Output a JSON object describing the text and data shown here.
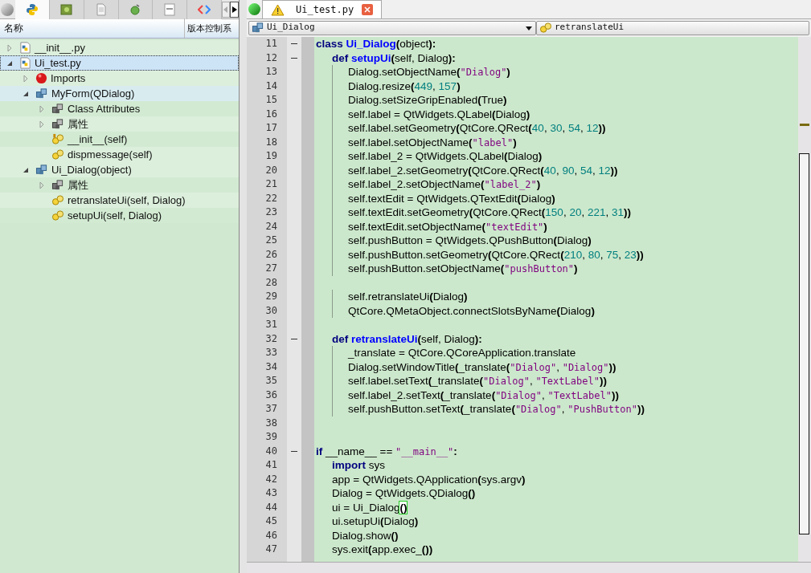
{
  "left_tabs": [
    {
      "kind": "python",
      "selected": true
    },
    {
      "kind": "image",
      "selected": false
    },
    {
      "kind": "page",
      "selected": false
    },
    {
      "kind": "bug",
      "selected": false
    },
    {
      "kind": "idl",
      "selected": false
    },
    {
      "kind": "protocol",
      "selected": false
    }
  ],
  "tree": {
    "columns": [
      "名称",
      "版本控制系"
    ],
    "items": [
      {
        "label": "__init__.py",
        "kind": "file",
        "expanded": false,
        "selected": false
      },
      {
        "label": "Ui_test.py",
        "kind": "file",
        "expanded": true,
        "selected": true,
        "children": [
          {
            "label": "Imports",
            "kind": "error",
            "expanded": false,
            "selected": false
          },
          {
            "label": "MyForm(QDialog)",
            "kind": "class",
            "expanded": true,
            "selected": false,
            "hovered": true,
            "children": [
              {
                "label": "Class Attributes",
                "kind": "attrs",
                "expanded": false,
                "selected": false
              },
              {
                "label": "属性",
                "kind": "attrs",
                "expanded": false,
                "selected": false
              },
              {
                "label": "__init__(self)",
                "kind": "init",
                "selected": false
              },
              {
                "label": "dispmessage(self)",
                "kind": "method",
                "selected": false
              }
            ]
          },
          {
            "label": "Ui_Dialog(object)",
            "kind": "class",
            "expanded": true,
            "selected": false,
            "children": [
              {
                "label": "属性",
                "kind": "attrs",
                "expanded": false,
                "selected": false
              },
              {
                "label": "retranslateUi(self, Dialog)",
                "kind": "method",
                "selected": false
              },
              {
                "label": "setupUi(self, Dialog)",
                "kind": "method",
                "selected": false
              }
            ]
          }
        ]
      }
    ]
  },
  "editor_tab": {
    "title": "Ui_test.py",
    "warning": true
  },
  "class_combo": "Ui_Dialog",
  "method_combo": "retranslateUi",
  "lines": [
    {
      "no": "11",
      "fold": true,
      "tokens": [
        {
          "kind": "kw",
          "text": "class "
        },
        {
          "kind": "fn",
          "text": "Ui_Dialog"
        },
        {
          "kind": "p",
          "text": "("
        },
        {
          "kind": "x",
          "text": "object"
        },
        {
          "kind": "p",
          "text": "):"
        }
      ]
    },
    {
      "no": "12",
      "fold": true,
      "tokens": [
        {
          "kind": "kw",
          "text": "    def "
        },
        {
          "kind": "fn",
          "text": "setupUi"
        },
        {
          "kind": "p",
          "text": "("
        },
        {
          "kind": "x",
          "text": "self, Dialog"
        },
        {
          "kind": "p",
          "text": "):"
        }
      ]
    },
    {
      "no": "13",
      "fold": false,
      "tokens": [
        {
          "kind": "x",
          "text": "        Dialog.setObjectName"
        },
        {
          "kind": "p",
          "text": "("
        },
        {
          "kind": "s",
          "text": "\"Dialog\""
        },
        {
          "kind": "p",
          "text": ")"
        }
      ]
    },
    {
      "no": "14",
      "fold": false,
      "tokens": [
        {
          "kind": "x",
          "text": "        Dialog.resize"
        },
        {
          "kind": "p",
          "text": "("
        },
        {
          "kind": "n",
          "text": "449"
        },
        {
          "kind": "x",
          "text": ", "
        },
        {
          "kind": "n",
          "text": "157"
        },
        {
          "kind": "p",
          "text": ")"
        }
      ]
    },
    {
      "no": "15",
      "fold": false,
      "tokens": [
        {
          "kind": "x",
          "text": "        Dialog.setSizeGripEnabled"
        },
        {
          "kind": "p",
          "text": "("
        },
        {
          "kind": "x",
          "text": "True"
        },
        {
          "kind": "p",
          "text": ")"
        }
      ]
    },
    {
      "no": "16",
      "fold": false,
      "tokens": [
        {
          "kind": "x",
          "text": "        self.label = QtWidgets.QLabel"
        },
        {
          "kind": "p",
          "text": "("
        },
        {
          "kind": "x",
          "text": "Dialog"
        },
        {
          "kind": "p",
          "text": ")"
        }
      ]
    },
    {
      "no": "17",
      "fold": false,
      "tokens": [
        {
          "kind": "x",
          "text": "        self.label.setGeometry"
        },
        {
          "kind": "p",
          "text": "("
        },
        {
          "kind": "x",
          "text": "QtCore.QRect"
        },
        {
          "kind": "p",
          "text": "("
        },
        {
          "kind": "n",
          "text": "40"
        },
        {
          "kind": "x",
          "text": ", "
        },
        {
          "kind": "n",
          "text": "30"
        },
        {
          "kind": "x",
          "text": ", "
        },
        {
          "kind": "n",
          "text": "54"
        },
        {
          "kind": "x",
          "text": ", "
        },
        {
          "kind": "n",
          "text": "12"
        },
        {
          "kind": "p",
          "text": "))"
        }
      ]
    },
    {
      "no": "18",
      "fold": false,
      "tokens": [
        {
          "kind": "x",
          "text": "        self.label.setObjectName"
        },
        {
          "kind": "p",
          "text": "("
        },
        {
          "kind": "s",
          "text": "\"label\""
        },
        {
          "kind": "p",
          "text": ")"
        }
      ]
    },
    {
      "no": "19",
      "fold": false,
      "tokens": [
        {
          "kind": "x",
          "text": "        self.label_2 = QtWidgets.QLabel"
        },
        {
          "kind": "p",
          "text": "("
        },
        {
          "kind": "x",
          "text": "Dialog"
        },
        {
          "kind": "p",
          "text": ")"
        }
      ]
    },
    {
      "no": "20",
      "fold": false,
      "tokens": [
        {
          "kind": "x",
          "text": "        self.label_2.setGeometry"
        },
        {
          "kind": "p",
          "text": "("
        },
        {
          "kind": "x",
          "text": "QtCore.QRect"
        },
        {
          "kind": "p",
          "text": "("
        },
        {
          "kind": "n",
          "text": "40"
        },
        {
          "kind": "x",
          "text": ", "
        },
        {
          "kind": "n",
          "text": "90"
        },
        {
          "kind": "x",
          "text": ", "
        },
        {
          "kind": "n",
          "text": "54"
        },
        {
          "kind": "x",
          "text": ", "
        },
        {
          "kind": "n",
          "text": "12"
        },
        {
          "kind": "p",
          "text": "))"
        }
      ]
    },
    {
      "no": "21",
      "fold": false,
      "tokens": [
        {
          "kind": "x",
          "text": "        self.label_2.setObjectName"
        },
        {
          "kind": "p",
          "text": "("
        },
        {
          "kind": "s",
          "text": "\"label_2\""
        },
        {
          "kind": "p",
          "text": ")"
        }
      ]
    },
    {
      "no": "22",
      "fold": false,
      "tokens": [
        {
          "kind": "x",
          "text": "        self.textEdit = QtWidgets.QTextEdit"
        },
        {
          "kind": "p",
          "text": "("
        },
        {
          "kind": "x",
          "text": "Dialog"
        },
        {
          "kind": "p",
          "text": ")"
        }
      ]
    },
    {
      "no": "23",
      "fold": false,
      "tokens": [
        {
          "kind": "x",
          "text": "        self.textEdit.setGeometry"
        },
        {
          "kind": "p",
          "text": "("
        },
        {
          "kind": "x",
          "text": "QtCore.QRect"
        },
        {
          "kind": "p",
          "text": "("
        },
        {
          "kind": "n",
          "text": "150"
        },
        {
          "kind": "x",
          "text": ", "
        },
        {
          "kind": "n",
          "text": "20"
        },
        {
          "kind": "x",
          "text": ", "
        },
        {
          "kind": "n",
          "text": "221"
        },
        {
          "kind": "x",
          "text": ", "
        },
        {
          "kind": "n",
          "text": "31"
        },
        {
          "kind": "p",
          "text": "))"
        }
      ]
    },
    {
      "no": "24",
      "fold": false,
      "tokens": [
        {
          "kind": "x",
          "text": "        self.textEdit.setObjectName"
        },
        {
          "kind": "p",
          "text": "("
        },
        {
          "kind": "s",
          "text": "\"textEdit\""
        },
        {
          "kind": "p",
          "text": ")"
        }
      ]
    },
    {
      "no": "25",
      "fold": false,
      "tokens": [
        {
          "kind": "x",
          "text": "        self.pushButton = QtWidgets.QPushButton"
        },
        {
          "kind": "p",
          "text": "("
        },
        {
          "kind": "x",
          "text": "Dialog"
        },
        {
          "kind": "p",
          "text": ")"
        }
      ]
    },
    {
      "no": "26",
      "fold": false,
      "tokens": [
        {
          "kind": "x",
          "text": "        self.pushButton.setGeometry"
        },
        {
          "kind": "p",
          "text": "("
        },
        {
          "kind": "x",
          "text": "QtCore.QRect"
        },
        {
          "kind": "p",
          "text": "("
        },
        {
          "kind": "n",
          "text": "210"
        },
        {
          "kind": "x",
          "text": ", "
        },
        {
          "kind": "n",
          "text": "80"
        },
        {
          "kind": "x",
          "text": ", "
        },
        {
          "kind": "n",
          "text": "75"
        },
        {
          "kind": "x",
          "text": ", "
        },
        {
          "kind": "n",
          "text": "23"
        },
        {
          "kind": "p",
          "text": "))"
        }
      ]
    },
    {
      "no": "27",
      "fold": false,
      "tokens": [
        {
          "kind": "x",
          "text": "        self.pushButton.setObjectName"
        },
        {
          "kind": "p",
          "text": "("
        },
        {
          "kind": "s",
          "text": "\"pushButton\""
        },
        {
          "kind": "p",
          "text": ")"
        }
      ]
    },
    {
      "no": "28",
      "fold": false
    },
    {
      "no": "29",
      "fold": false,
      "tokens": [
        {
          "kind": "x",
          "text": "        self.retranslateUi"
        },
        {
          "kind": "p",
          "text": "("
        },
        {
          "kind": "x",
          "text": "Dialog"
        },
        {
          "kind": "p",
          "text": ")"
        }
      ]
    },
    {
      "no": "30",
      "fold": false,
      "tokens": [
        {
          "kind": "x",
          "text": "        QtCore.QMetaObject.connectSlotsByName"
        },
        {
          "kind": "p",
          "text": "("
        },
        {
          "kind": "x",
          "text": "Dialog"
        },
        {
          "kind": "p",
          "text": ")"
        }
      ]
    },
    {
      "no": "31",
      "fold": false
    },
    {
      "no": "32",
      "fold": true,
      "tokens": [
        {
          "kind": "kw",
          "text": "    def "
        },
        {
          "kind": "fn",
          "text": "retranslateUi"
        },
        {
          "kind": "p",
          "text": "("
        },
        {
          "kind": "x",
          "text": "self, Dialog"
        },
        {
          "kind": "p",
          "text": "):"
        }
      ]
    },
    {
      "no": "33",
      "fold": false,
      "tokens": [
        {
          "kind": "x",
          "text": "        _translate = QtCore.QCoreApplication.translate"
        }
      ]
    },
    {
      "no": "34",
      "fold": false,
      "tokens": [
        {
          "kind": "x",
          "text": "        Dialog.setWindowTitle"
        },
        {
          "kind": "p",
          "text": "("
        },
        {
          "kind": "x",
          "text": "_translate"
        },
        {
          "kind": "p",
          "text": "("
        },
        {
          "kind": "s",
          "text": "\"Dialog\""
        },
        {
          "kind": "x",
          "text": ", "
        },
        {
          "kind": "s",
          "text": "\"Dialog\""
        },
        {
          "kind": "p",
          "text": "))"
        }
      ]
    },
    {
      "no": "35",
      "fold": false,
      "tokens": [
        {
          "kind": "x",
          "text": "        self.label.setText"
        },
        {
          "kind": "p",
          "text": "("
        },
        {
          "kind": "x",
          "text": "_translate"
        },
        {
          "kind": "p",
          "text": "("
        },
        {
          "kind": "s",
          "text": "\"Dialog\""
        },
        {
          "kind": "x",
          "text": ", "
        },
        {
          "kind": "s",
          "text": "\"TextLabel\""
        },
        {
          "kind": "p",
          "text": "))"
        }
      ]
    },
    {
      "no": "36",
      "fold": false,
      "tokens": [
        {
          "kind": "x",
          "text": "        self.label_2.setText"
        },
        {
          "kind": "p",
          "text": "("
        },
        {
          "kind": "x",
          "text": "_translate"
        },
        {
          "kind": "p",
          "text": "("
        },
        {
          "kind": "s",
          "text": "\"Dialog\""
        },
        {
          "kind": "x",
          "text": ", "
        },
        {
          "kind": "s",
          "text": "\"TextLabel\""
        },
        {
          "kind": "p",
          "text": "))"
        }
      ]
    },
    {
      "no": "37",
      "fold": false,
      "tokens": [
        {
          "kind": "x",
          "text": "        self.pushButton.setText"
        },
        {
          "kind": "p",
          "text": "("
        },
        {
          "kind": "x",
          "text": "_translate"
        },
        {
          "kind": "p",
          "text": "("
        },
        {
          "kind": "s",
          "text": "\"Dialog\""
        },
        {
          "kind": "x",
          "text": ", "
        },
        {
          "kind": "s",
          "text": "\"PushButton\""
        },
        {
          "kind": "p",
          "text": "))"
        }
      ]
    },
    {
      "no": "38",
      "fold": false
    },
    {
      "no": "39",
      "fold": false
    },
    {
      "no": "40",
      "fold": true,
      "tokens": [
        {
          "kind": "kw",
          "text": "if "
        },
        {
          "kind": "x",
          "text": "__name__ == "
        },
        {
          "kind": "s",
          "text": "\"__main__\""
        },
        {
          "kind": "p",
          "text": ":"
        }
      ]
    },
    {
      "no": "41",
      "fold": false,
      "tokens": [
        {
          "kind": "kw",
          "text": "    import "
        },
        {
          "kind": "x",
          "text": "sys"
        }
      ]
    },
    {
      "no": "42",
      "fold": false,
      "tokens": [
        {
          "kind": "x",
          "text": "    app = QtWidgets.QApplication"
        },
        {
          "kind": "p",
          "text": "("
        },
        {
          "kind": "x",
          "text": "sys.argv"
        },
        {
          "kind": "p",
          "text": ")"
        }
      ]
    },
    {
      "no": "43",
      "fold": false,
      "tokens": [
        {
          "kind": "x",
          "text": "    Dialog = QtWidgets.QDialog"
        },
        {
          "kind": "p",
          "text": "()"
        }
      ]
    },
    {
      "no": "44",
      "fold": false,
      "tokens": [
        {
          "kind": "x",
          "text": "    ui = Ui_Dialog"
        },
        {
          "kind": "m",
          "text": "()"
        }
      ]
    },
    {
      "no": "45",
      "fold": false,
      "tokens": [
        {
          "kind": "x",
          "text": "    ui.setupUi"
        },
        {
          "kind": "p",
          "text": "("
        },
        {
          "kind": "x",
          "text": "Dialog"
        },
        {
          "kind": "p",
          "text": ")"
        }
      ]
    },
    {
      "no": "46",
      "fold": false,
      "tokens": [
        {
          "kind": "x",
          "text": "    Dialog.show"
        },
        {
          "kind": "p",
          "text": "()"
        }
      ]
    },
    {
      "no": "47",
      "fold": false,
      "tokens": [
        {
          "kind": "x",
          "text": "    sys.exit"
        },
        {
          "kind": "p",
          "text": "("
        },
        {
          "kind": "x",
          "text": "app.exec_"
        },
        {
          "kind": "p",
          "text": "())"
        }
      ]
    }
  ]
}
